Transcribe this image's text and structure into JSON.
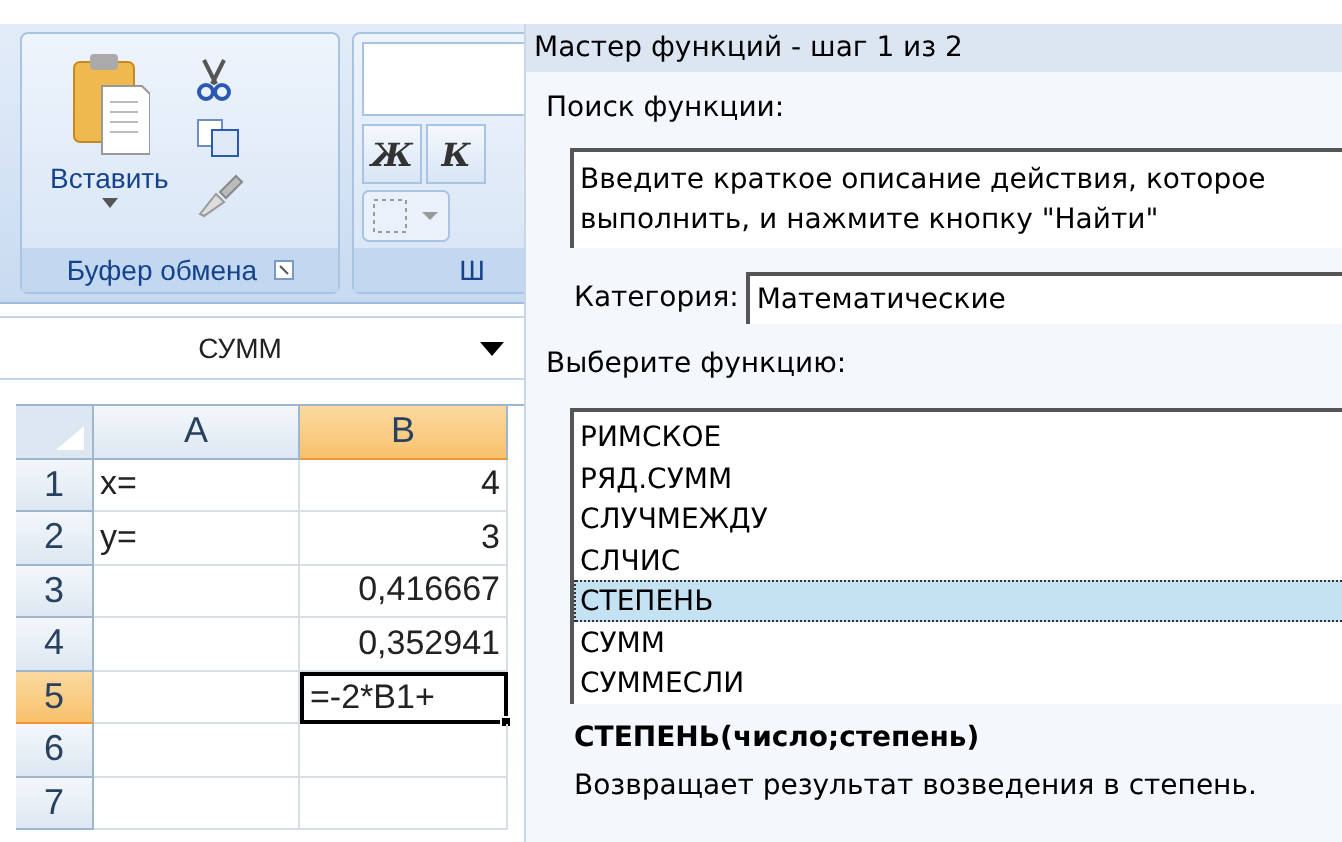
{
  "ribbon": {
    "clipboard": {
      "paste_label": "Вставить",
      "group_label": "Буфер обмена"
    },
    "font": {
      "bold_label": "Ж",
      "italic_label": "К",
      "group_label": "Ш"
    }
  },
  "name_box": {
    "value": "СУММ"
  },
  "sheet": {
    "columns": [
      {
        "label": "A",
        "selected": false
      },
      {
        "label": "B",
        "selected": true
      }
    ],
    "rows": [
      {
        "header": "1",
        "selected": false,
        "cells": [
          {
            "text": "x=",
            "kind": "text",
            "active": false
          },
          {
            "text": "4",
            "kind": "number",
            "active": false
          }
        ]
      },
      {
        "header": "2",
        "selected": false,
        "cells": [
          {
            "text": "y=",
            "kind": "text",
            "active": false
          },
          {
            "text": "3",
            "kind": "number",
            "active": false
          }
        ]
      },
      {
        "header": "3",
        "selected": false,
        "cells": [
          {
            "kind": "empty",
            "active": false
          },
          {
            "text": "0,416667",
            "kind": "number",
            "active": false
          }
        ]
      },
      {
        "header": "4",
        "selected": false,
        "cells": [
          {
            "kind": "empty",
            "active": false
          },
          {
            "text": "0,352941",
            "kind": "number",
            "active": false
          }
        ]
      },
      {
        "header": "5",
        "selected": true,
        "cells": [
          {
            "kind": "empty",
            "active": false
          },
          {
            "text": "=-2*B1+",
            "kind": "formula",
            "active": true
          }
        ]
      },
      {
        "header": "6",
        "selected": false,
        "cells": [
          {
            "kind": "empty",
            "active": false
          },
          {
            "kind": "empty",
            "active": false
          }
        ]
      },
      {
        "header": "7",
        "selected": false,
        "cells": [
          {
            "kind": "empty",
            "active": false
          },
          {
            "kind": "empty",
            "active": false
          }
        ]
      }
    ]
  },
  "dialog": {
    "title": "Мастер функций - шаг 1 из 2",
    "search_label": "Поиск функции:",
    "search_value": "Введите краткое описание действия, которое\nвыполнить, и нажмите кнопку \"Найти\"",
    "category_label": "Категория:",
    "category_value": "Математические",
    "list_label": "Выберите функцию:",
    "functions": [
      {
        "name": "РИМСКОЕ",
        "selected": false
      },
      {
        "name": "РЯД.СУММ",
        "selected": false
      },
      {
        "name": "СЛУЧМЕЖДУ",
        "selected": false
      },
      {
        "name": "СЛЧИС",
        "selected": false
      },
      {
        "name": "СТЕПЕНЬ",
        "selected": true
      },
      {
        "name": "СУММ",
        "selected": false
      },
      {
        "name": "СУММЕСЛИ",
        "selected": false
      }
    ],
    "signature": "СТЕПЕНЬ(число;степень)",
    "description": "Возвращает результат возведения в степень."
  }
}
